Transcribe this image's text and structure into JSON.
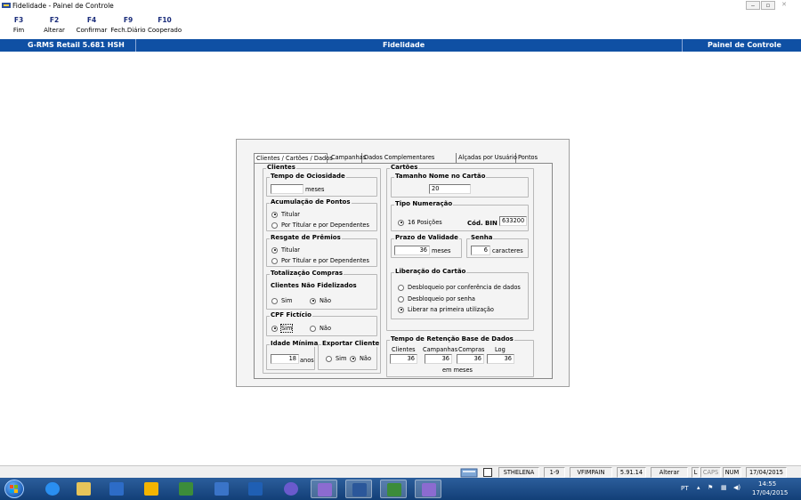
{
  "window": {
    "title": "Fidelidade - Painel de Controle"
  },
  "toolbar": {
    "keys": [
      {
        "key": "F3",
        "label": "Fim"
      },
      {
        "key": "F2",
        "label": "Alterar"
      },
      {
        "key": "F4",
        "label": "Confirmar"
      },
      {
        "key": "F9",
        "label": "Fech.Diário"
      },
      {
        "key": "F10",
        "label": "Cooperado"
      }
    ]
  },
  "header": {
    "left": "G-RMS Retail 5.681 HSH",
    "center": "Fidelidade",
    "right": "Painel de Controle"
  },
  "tabs": [
    {
      "label": "Clientes / Cartões / Dados",
      "active": true
    },
    {
      "label": "Campanhas"
    },
    {
      "label": "Dados Complementares"
    },
    {
      "label": "Alçadas por Usuário"
    },
    {
      "label": "Pontos"
    }
  ],
  "clientes": {
    "title": "Clientes",
    "ociosidade": {
      "title": "Tempo de Ociosidade",
      "value": "",
      "unit": "meses"
    },
    "acumulacao": {
      "title": "Acumulação de Pontos",
      "options": [
        "Titular",
        "Por Titular e por Dependentes"
      ],
      "selected": "Titular"
    },
    "resgate": {
      "title": "Resgate de Prêmios",
      "options": [
        "Titular",
        "Por Titular e por Dependentes"
      ],
      "selected": "Titular"
    },
    "totalizacao": {
      "title": "Totalização Compras",
      "subtitle": "Clientes Não Fidelizados",
      "options": [
        "Sim",
        "Não"
      ],
      "selected": "Não"
    },
    "cpf": {
      "title": "CPF Fictício",
      "options": [
        "Sim",
        "Não"
      ],
      "selected": "Sim"
    },
    "idade": {
      "title": "Idade Mínima",
      "value": "18",
      "unit": "anos"
    },
    "exportar": {
      "title": "Exportar Cliente",
      "options": [
        "Sim",
        "Não"
      ],
      "selected": "Não"
    }
  },
  "cartoes": {
    "title": "Cartões",
    "tamanho": {
      "title": "Tamanho Nome no Cartão",
      "value": "20"
    },
    "numeracao": {
      "title": "Tipo Numeração",
      "option": "16 Posições",
      "bin_label": "Cód. BIN",
      "bin_value": "633200"
    },
    "validade": {
      "title": "Prazo de Validade",
      "value": "36",
      "unit": "meses"
    },
    "senha": {
      "title": "Senha",
      "value": "6",
      "unit": "caracteres"
    },
    "liberacao": {
      "title": "Liberação do Cartão",
      "options": [
        "Desbloqueio por conferência de dados",
        "Desbloqueio por senha",
        "Liberar na primeira utilização"
      ],
      "selected": "Liberar na primeira utilização"
    }
  },
  "retencao": {
    "title": "Tempo de Retenção Base de Dados",
    "columns": [
      "Clientes",
      "Campanhas",
      "Compras",
      "Log"
    ],
    "values": [
      "36",
      "36",
      "36",
      "36"
    ],
    "unit": "em meses"
  },
  "statusbar": {
    "user": "STHELENA",
    "range": "1-9",
    "program": "VFIMPAIN",
    "version": "5.91.14",
    "mode": "Alterar",
    "l": "L",
    "caps": "CAPS",
    "num": "NUM",
    "date": "17/04/2015"
  },
  "taskbar": {
    "lang": "PT",
    "time": "14:55",
    "date": "17/04/2015"
  }
}
